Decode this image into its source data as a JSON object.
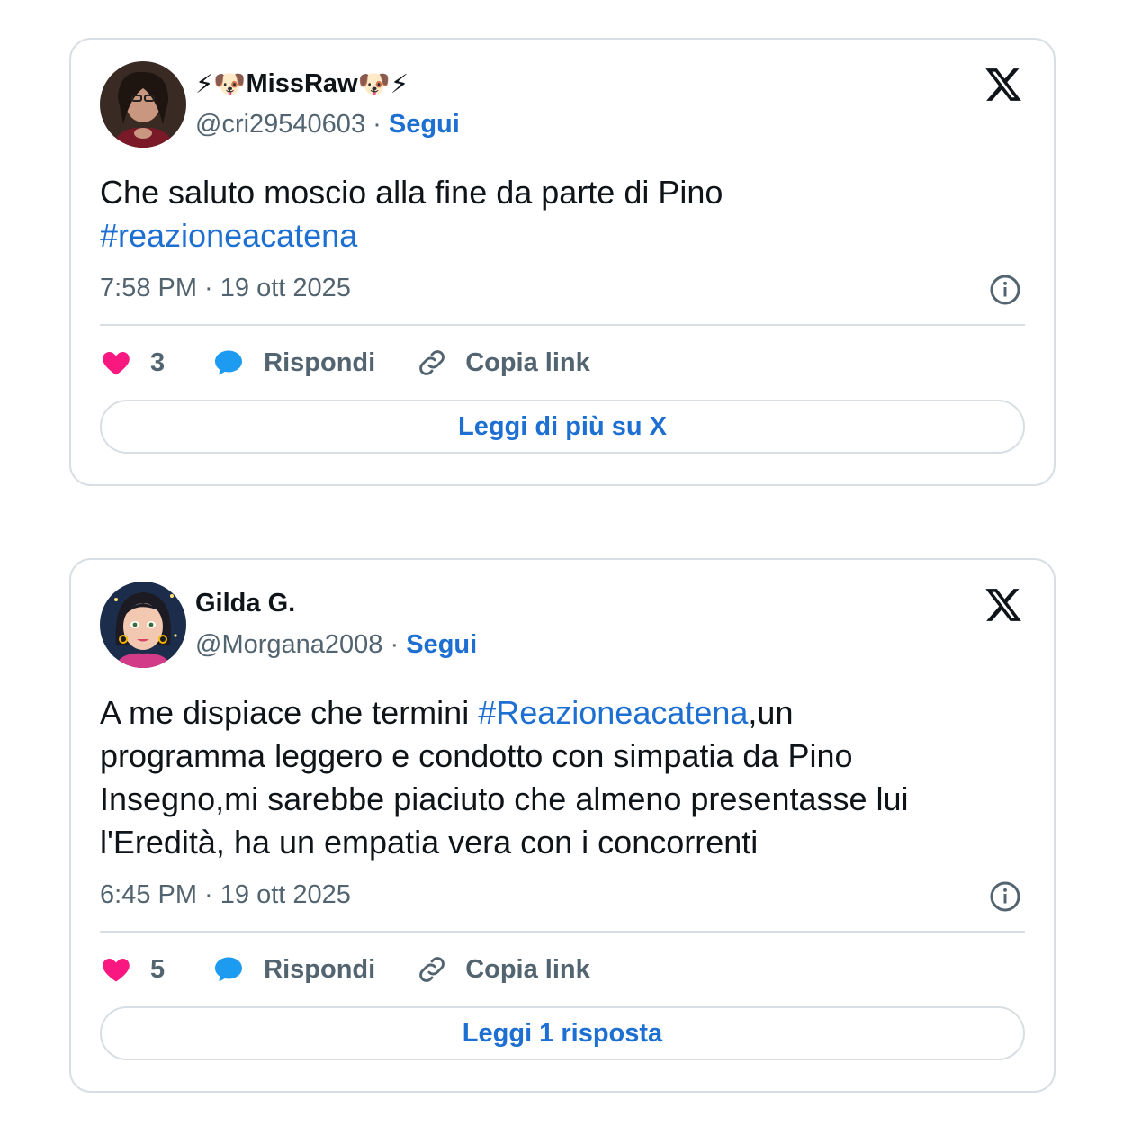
{
  "tweets": [
    {
      "display_name": "MissRaw",
      "name_decoration_left": "⚡🐶",
      "name_decoration_right": "🐶⚡",
      "handle": "@cri29540603",
      "separator": "·",
      "follow_label": "Segui",
      "text_lines": [
        "Che saluto moscio alla fine da parte di Pino"
      ],
      "hashtag_line": "#reazioneacatena",
      "timestamp": "7:58 PM · 19 ott 2025",
      "likes": "3",
      "reply_label": "Rispondi",
      "copy_label": "Copia link",
      "read_more_label": "Leggi di più su X"
    },
    {
      "display_name": "Gilda G.",
      "handle": "@Morgana2008",
      "separator": "·",
      "follow_label": "Segui",
      "text_line1_pre": "A me dispiace che termini ",
      "text_line1_hashtag": "#Reazioneacatena",
      "text_line1_post": ",un",
      "text_line2": "programma leggero e condotto con simpatia da Pino",
      "text_line3": "Insegno,mi sarebbe piaciuto che almeno presentasse lui",
      "text_line4": "l'Eredità, ha un empatia vera con i concorrenti",
      "timestamp": "6:45 PM · 19 ott 2025",
      "likes": "5",
      "reply_label": "Rispondi",
      "copy_label": "Copia link",
      "read_more_label": "Leggi 1 risposta"
    }
  ],
  "icons": {
    "brand": "x-logo-icon",
    "like": "heart-icon",
    "reply": "speech-bubble-icon",
    "copy": "link-icon",
    "info": "info-icon"
  },
  "colors": {
    "accent": "#1d6fd1",
    "heart": "#f91880",
    "reply": "#1d9bf0",
    "muted": "#536471",
    "border": "#d9dee3"
  }
}
